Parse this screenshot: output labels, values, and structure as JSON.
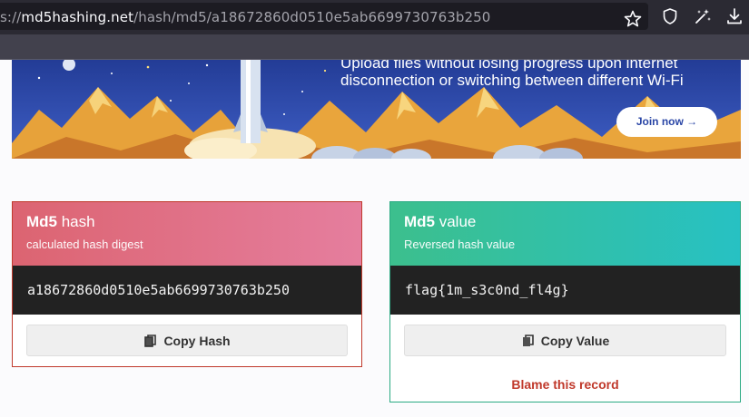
{
  "browser": {
    "url_prefix": "s://",
    "url_host": "md5hashing.net",
    "url_path": "/hash/md5/a18672860d0510e5ab6699730763b250"
  },
  "banner": {
    "line1": "Upload files without losing progress upon internet",
    "line2": "disconnection or switching between different Wi-Fi",
    "join_label": "Join now →"
  },
  "hash_card": {
    "title_bold": "Md5",
    "title_rest": " hash",
    "subtitle": "calculated hash digest",
    "value": "a18672860d0510e5ab6699730763b250",
    "copy_label": "Copy Hash"
  },
  "value_card": {
    "title_bold": "Md5",
    "title_rest": " value",
    "subtitle": "Reversed hash value",
    "value": "flag{1m_s3c0nd_fl4g}",
    "copy_label": "Copy Value",
    "blame_label": "Blame this record"
  },
  "colors": {
    "hash_accent": "#c0392b",
    "value_accent": "#2aaa83"
  },
  "icons": [
    "star-icon",
    "shield-icon",
    "magic-wand-icon",
    "download-icon",
    "copy-icon",
    "arrow-right-icon"
  ]
}
